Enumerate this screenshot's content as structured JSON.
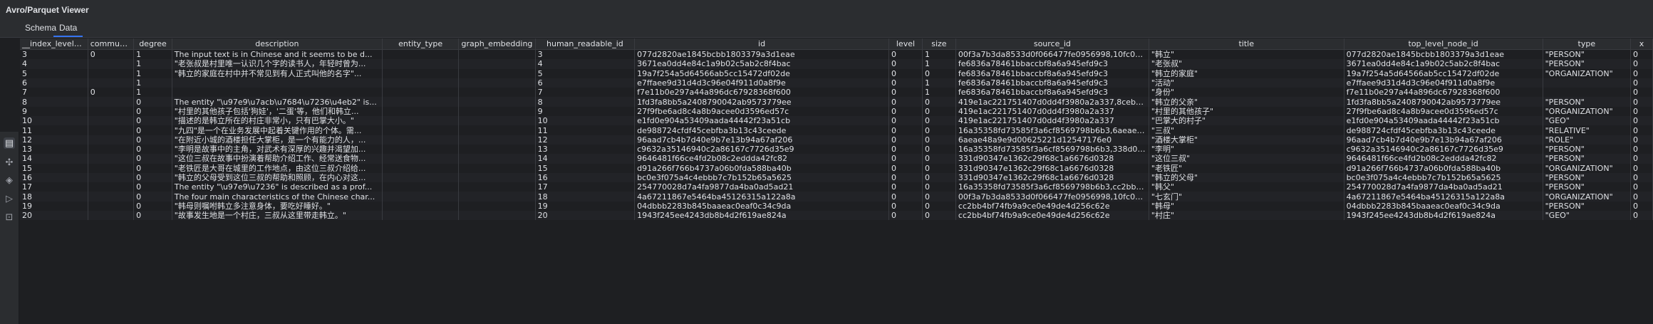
{
  "window": {
    "title": "Avro/Parquet Viewer"
  },
  "tabs": [
    {
      "label": "Schema"
    },
    {
      "label": "Data"
    }
  ],
  "table": {
    "columns": [
      "__index_level_0__",
      "community",
      "degree",
      "description",
      "entity_type",
      "graph_embedding",
      "human_readable_id",
      "id",
      "level",
      "size",
      "source_id",
      "title",
      "top_level_node_id",
      "type",
      "x"
    ],
    "rows": [
      [
        "3",
        "0",
        "1",
        "The input text is in Chinese and it seems to be d...",
        "",
        "",
        "3",
        "077d2820ae1845bcbb1803379a3d1eae",
        "0",
        "1",
        "00f3a7b3da8533d0f066477fe0956998,10fc06fe83...",
        "\"韩立\"",
        "077d2820ae1845bcbb1803379a3d1eae",
        "\"PERSON\"",
        "0"
      ],
      [
        "4",
        "",
        "1",
        "\"老张叔是村里唯一认识几个字的读书人，年轻时曾为...",
        "",
        "",
        "4",
        "3671ea0dd4e84c1a9b02c5ab2c8f4bac",
        "0",
        "1",
        "fe6836a78461bbaccbf8a6a945efd9c3",
        "\"老张叔\"",
        "3671ea0dd4e84c1a9b02c5ab2c8f4bac",
        "\"PERSON\"",
        "0"
      ],
      [
        "5",
        "",
        "1",
        "\"韩立的家庭在村中并不常见到有人正式叫他的名字\"...",
        "",
        "",
        "5",
        "19a7f254a5d64566ab5cc15472df02de",
        "0",
        "0",
        "fe6836a78461bbaccbf8a6a945efd9c3",
        "\"韩立的家庭\"",
        "19a7f254a5d64566ab5cc15472df02de",
        "\"ORGANIZATION\"",
        "0"
      ],
      [
        "6",
        "",
        "1",
        "",
        "",
        "",
        "6",
        "e7ffaee9d31d4d3c96e04f911d0a8f9e",
        "0",
        "1",
        "fe6836a78461bbaccbf8a6a945efd9c3",
        "\"活动\"",
        "e7ffaee9d31d4d3c96e04f911d0a8f9e",
        "",
        "0"
      ],
      [
        "7",
        "0",
        "1",
        "",
        "",
        "",
        "7",
        "f7e11b0e297a44a896dc67928368f600",
        "0",
        "1",
        "fe6836a78461bbaccbf8a6a945efd9c3",
        "\"身份\"",
        "f7e11b0e297a44a896dc67928368f600",
        "",
        "0"
      ],
      [
        "8",
        "",
        "0",
        "The entity \"\\u97e9\\u7acb\\u7684\\u7236\\u4eb2\" is...",
        "",
        "",
        "8",
        "1fd3fa8bb5a2408790042ab9573779ee",
        "0",
        "0",
        "419e1ac221751407d0dd4f3980a2a337,8ceb611...",
        "\"韩立的父亲\"",
        "1fd3fa8bb5a2408790042ab9573779ee",
        "\"PERSON\"",
        "0"
      ],
      [
        "9",
        "",
        "0",
        "\"村里的其他孩子包括'狗娃'，'二蛋'等，他们和韩立...",
        "",
        "",
        "9",
        "27f9fbe6ad8c4a8b9acee0d3596ed57c",
        "0",
        "0",
        "419e1ac221751407d0dd4f3980a2a337",
        "\"村里的其他孩子\"",
        "27f9fbe6ad8c4a8b9acee0d3596ed57c",
        "\"ORGANIZATION\"",
        "0"
      ],
      [
        "10",
        "",
        "0",
        "\"描述的是韩立所在的村庄非常小，只有巴掌大小。\"",
        "",
        "",
        "10",
        "e1fd0e904a53409aada44442f23a51cb",
        "0",
        "0",
        "419e1ac221751407d0dd4f3980a2a337",
        "\"巴掌大的村子\"",
        "e1fd0e904a53409aada44442f23a51cb",
        "\"GEO\"",
        "0"
      ],
      [
        "11",
        "",
        "0",
        "\"九四\"是一个在业务发展中起着关键作用的个体。需...",
        "",
        "",
        "11",
        "de988724cfdf45cebfba3b13c43ceede",
        "0",
        "0",
        "16a35358fd73585f3a6cf8569798b6b3,6aeae48a9...",
        "\"三叔\"",
        "de988724cfdf45cebfba3b13c43ceede",
        "\"RELATIVE\"",
        "0"
      ],
      [
        "12",
        "",
        "0",
        "\"在附近小城的酒楼担任大掌柜，是一个有能力的人，...",
        "",
        "",
        "12",
        "96aad7cb4b7d40e9b7e13b94a67af206",
        "0",
        "0",
        "6aeae48a9e9d00625221d12547176e0",
        "\"酒楼大掌柜\"",
        "96aad7cb4b7d40e9b7e13b94a67af206",
        "\"ROLE\"",
        "0"
      ],
      [
        "13",
        "",
        "0",
        "\"李明是故事中的主角，对武术有深厚的兴趣并渴望加...",
        "",
        "",
        "13",
        "c9632a35146940c2a86167c7726d35e9",
        "0",
        "0",
        "16a35358fd73585f3a6cf8569798b6b3,338d066c1...",
        "\"李明\"",
        "c9632a35146940c2a86167c7726d35e9",
        "\"PERSON\"",
        "0"
      ],
      [
        "14",
        "",
        "0",
        "\"这位三叔在故事中扮演着帮助介绍工作、经常送食物...",
        "",
        "",
        "14",
        "9646481f66ce4fd2b08c2eddda42fc82",
        "0",
        "0",
        "331d90347e1362c29f68c1a6676d0328",
        "\"这位三叔\"",
        "9646481f66ce4fd2b08c2eddda42fc82",
        "\"PERSON\"",
        "0"
      ],
      [
        "15",
        "",
        "0",
        "\"老铁匠是大哥在城里的工作地点，由这位三叔介绍给...",
        "",
        "",
        "15",
        "d91a266f766b4737a06b0fda588ba40b",
        "0",
        "0",
        "331d90347e1362c29f68c1a6676d0328",
        "\"老铁匠\"",
        "d91a266f766b4737a06b0fda588ba40b",
        "\"ORGANIZATION\"",
        "0"
      ],
      [
        "16",
        "",
        "0",
        "\"韩立的父母受到这位三叔的帮助和照顾，在内心对这...",
        "",
        "",
        "16",
        "bc0e3f075a4c4ebbb7c7b152b65a5625",
        "0",
        "0",
        "331d90347e1362c29f68c1a6676d0328",
        "\"韩立的父母\"",
        "bc0e3f075a4c4ebbb7c7b152b65a5625",
        "\"PERSON\"",
        "0"
      ],
      [
        "17",
        "",
        "0",
        "The entity \"\\u97e9\\u7236\" is described as a prof...",
        "",
        "",
        "17",
        "254770028d7a4fa9877da4ba0ad5ad21",
        "0",
        "0",
        "16a35358fd73585f3a6cf8569798b6b3,cc2bb4bf7...",
        "\"韩父\"",
        "254770028d7a4fa9877da4ba0ad5ad21",
        "\"PERSON\"",
        "0"
      ],
      [
        "18",
        "",
        "0",
        "The four main characteristics of the Chinese char...",
        "",
        "",
        "18",
        "4a67211867e5464ba45126315a122a8a",
        "0",
        "0",
        "00f3a7b3da8533d0f066477fe0956998,10fc06fe83...",
        "\"七玄门\"",
        "4a67211867e5464ba45126315a122a8a",
        "\"ORGANIZATION\"",
        "0"
      ],
      [
        "19",
        "",
        "0",
        "\"韩母则嘱咐韩立多注意身体，要吃好睡好。\"",
        "",
        "",
        "19",
        "04dbbb2283b845baaeac0eaf0c34c9da",
        "0",
        "0",
        "cc2bb4bf74fb9a9ce0e49de4d256c62e",
        "\"韩母\"",
        "04dbbb2283b845baaeac0eaf0c34c9da",
        "\"PERSON\"",
        "0"
      ],
      [
        "20",
        "",
        "0",
        "\"故事发生地是一个村庄，三叔从这里带走韩立。\"",
        "",
        "",
        "20",
        "1943f245ee4243db8b4d2f619ae824a",
        "0",
        "0",
        "cc2bb4bf74fb9a9ce0e49de4d256c62e",
        "\"村庄\"",
        "1943f245ee4243db8b4d2f619ae824a",
        "\"GEO\"",
        "0"
      ]
    ]
  },
  "sidebar": {
    "icons": [
      "document-icon",
      "puzzle-icon",
      "layers-icon",
      "run-icon",
      "terminal-icon"
    ]
  }
}
